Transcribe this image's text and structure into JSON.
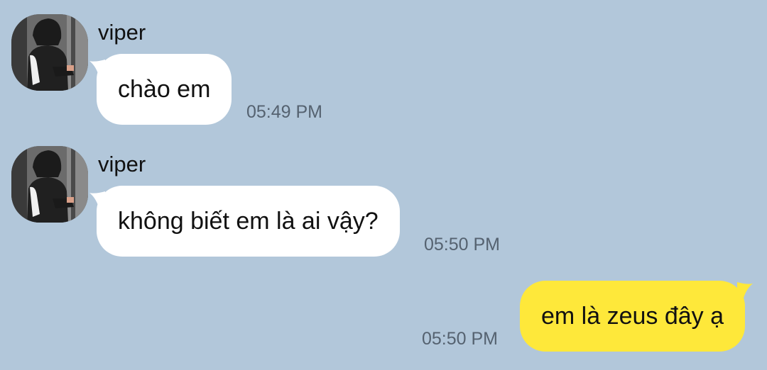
{
  "theme": {
    "background": "#b2c7da",
    "incoming_bubble": "#ffffff",
    "outgoing_bubble": "#fee83a",
    "timestamp_color": "#556270"
  },
  "messages": [
    {
      "direction": "incoming",
      "sender": "viper",
      "avatar_icon": "profile-photo-hooded-person-icon",
      "text": "chào em",
      "time": "05:49 PM"
    },
    {
      "direction": "incoming",
      "sender": "viper",
      "avatar_icon": "profile-photo-hooded-person-icon",
      "text": "không biết em là ai vậy?",
      "time": "05:50 PM"
    },
    {
      "direction": "outgoing",
      "text": "em là zeus đây ạ",
      "time": "05:50 PM"
    }
  ]
}
